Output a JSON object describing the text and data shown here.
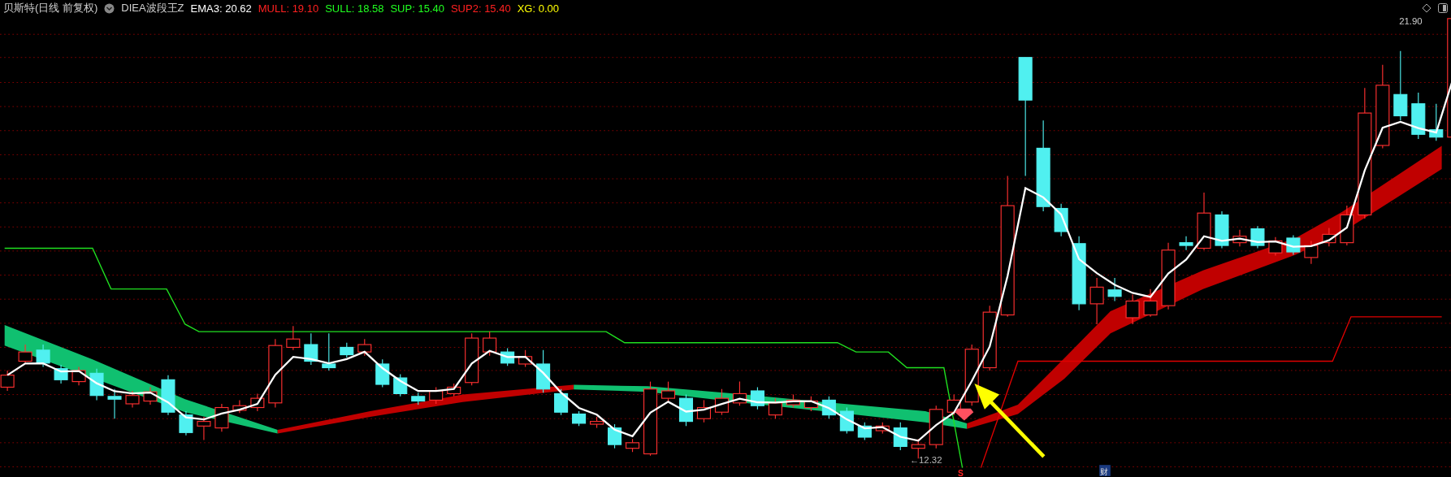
{
  "header": {
    "stock": "贝斯特",
    "period": "(日线 前复权)",
    "indicator": "DIEA波段王Z",
    "values": [
      {
        "label": "EMA3: 20.62",
        "color": "#ffffff"
      },
      {
        "label": "MULL: 19.10",
        "color": "#ff2020"
      },
      {
        "label": "SULL: 18.58",
        "color": "#20ff20"
      },
      {
        "label": "SUP: 15.40",
        "color": "#20ff20"
      },
      {
        "label": "SUP2: 15.40",
        "color": "#ff2020"
      },
      {
        "label": "XG: 0.00",
        "color": "#ffff00"
      }
    ]
  },
  "chart": {
    "high_label": "21.90",
    "low_label": "←12.32",
    "signal": "S",
    "marker": "财"
  }
}
